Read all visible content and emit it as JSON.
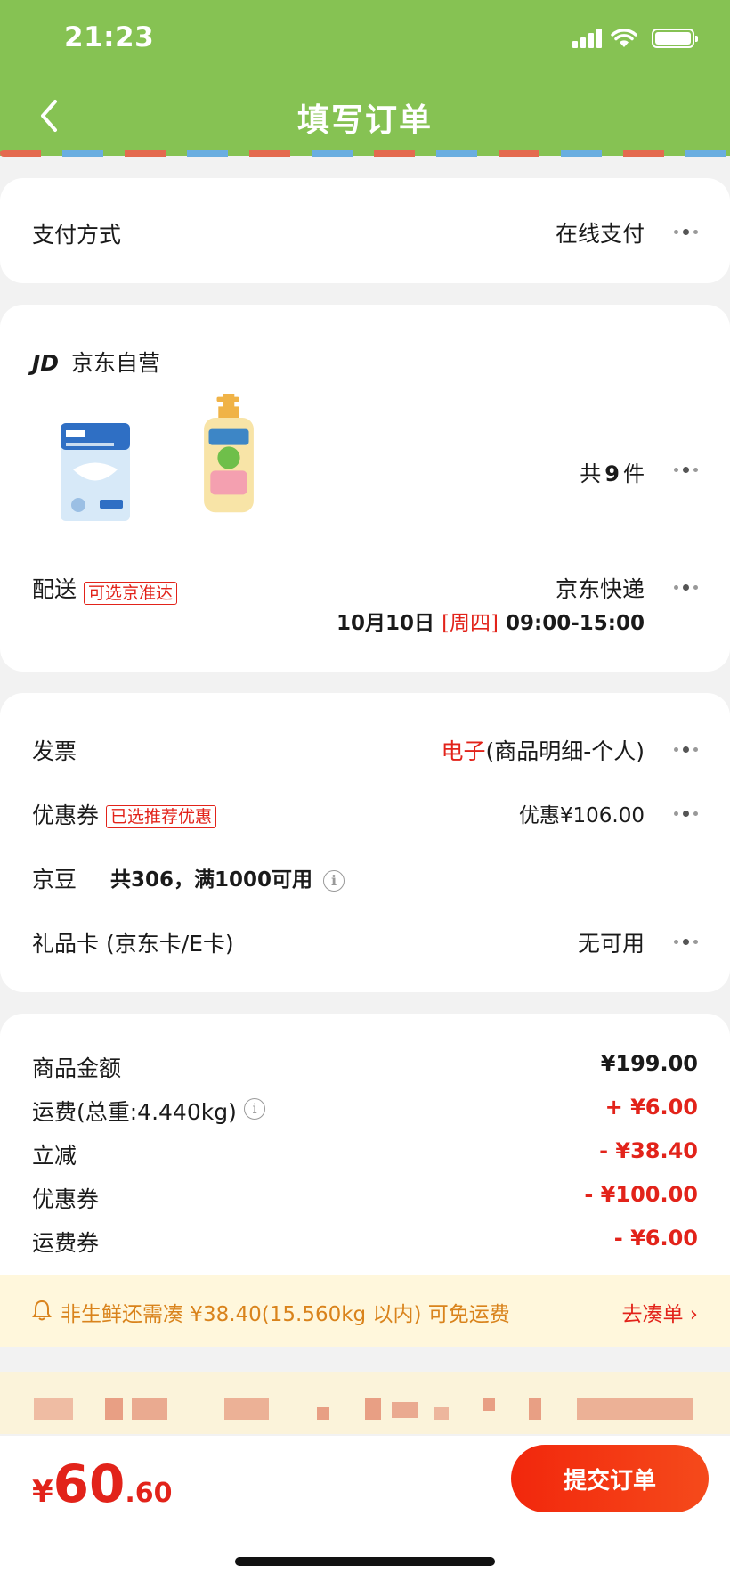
{
  "status_bar": {
    "time": "21:23"
  },
  "nav": {
    "title": "填写订单"
  },
  "payment": {
    "label": "支付方式",
    "value": "在线支付"
  },
  "shop": {
    "logo": "JD",
    "name": "京东自营",
    "count_prefix": "共",
    "count_num": "9",
    "count_suffix": "件",
    "delivery_label": "配送",
    "delivery_tag": "可选京准达",
    "courier": "京东快递",
    "date": "10月10日",
    "weekday": "[周四]",
    "time_range": "09:00-15:00"
  },
  "options": {
    "invoice_label": "发票",
    "invoice_type": "电子",
    "invoice_detail": "(商品明细-个人)",
    "coupon_label": "优惠券",
    "coupon_tag": "已选推荐优惠",
    "coupon_value": "优惠¥106.00",
    "beans_label": "京豆",
    "beans_text": "共306，满1000可用",
    "giftcard_label": "礼品卡 (京东卡/E卡)",
    "giftcard_value": "无可用"
  },
  "summary": [
    {
      "label": "商品金额",
      "amount": "¥199.00",
      "color": "#1a1a1a"
    },
    {
      "label": "运费(总重:4.440kg)",
      "amount": "+ ¥6.00",
      "color": "#e2231a"
    },
    {
      "label": "立减",
      "amount": "- ¥38.40",
      "color": "#e2231a"
    },
    {
      "label": "优惠券",
      "amount": "- ¥100.00",
      "color": "#e2231a"
    },
    {
      "label": "运费券",
      "amount": "- ¥6.00",
      "color": "#e2231a"
    }
  ],
  "banner": {
    "text": "非生鲜还需凑 ¥38.40(15.560kg 以内) 可免运费",
    "link": "去凑单 ›"
  },
  "footer": {
    "currency": "¥",
    "total_int": "60",
    "total_dec": ".60",
    "submit": "提交订单"
  },
  "colors": {
    "header": "#86c253",
    "accent": "#e2231a",
    "banner_text": "#d9831c"
  }
}
